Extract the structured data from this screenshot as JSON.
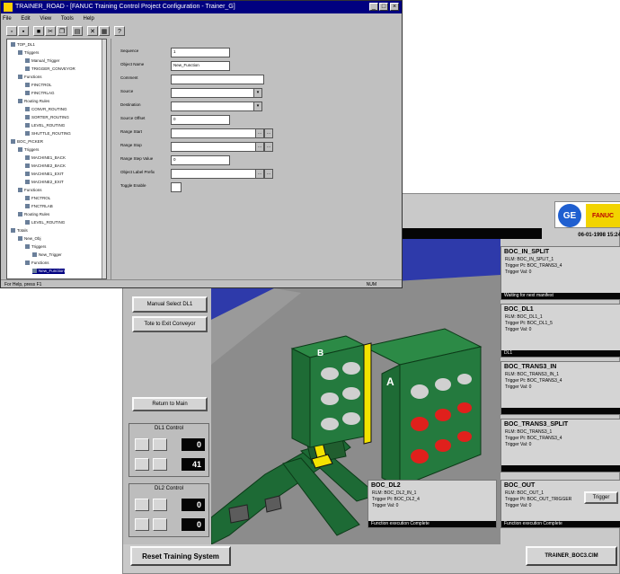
{
  "config_window": {
    "title": "TRAINER_ROAD - [FANUC Training Control Project Configuration - Trainer_G]",
    "menu": [
      "File",
      "Edit",
      "View",
      "Tools",
      "Help"
    ],
    "toolbar_icons": [
      "new-icon",
      "open-icon",
      "save-icon",
      "cut-icon",
      "copy-icon",
      "paste-icon",
      "delete-icon",
      "properties-icon",
      "help-icon"
    ],
    "tree": {
      "nodes": [
        {
          "label": "TOP_DL1",
          "level": 0
        },
        {
          "label": "Triggers",
          "level": 1
        },
        {
          "label": "Manual_Trigger",
          "level": 2
        },
        {
          "label": "TRIGGER_CONVEYOR",
          "level": 2
        },
        {
          "label": "Functions",
          "level": 1
        },
        {
          "label": "FINCTROL",
          "level": 2
        },
        {
          "label": "FINCTRLAG",
          "level": 2
        },
        {
          "label": "Routing Rules",
          "level": 1
        },
        {
          "label": "CONVR_ROUTING",
          "level": 2
        },
        {
          "label": "SORTER_ROUTING",
          "level": 2
        },
        {
          "label": "LEVEL_ROUTING",
          "level": 2
        },
        {
          "label": "SHUTTLE_ROUTING",
          "level": 2
        },
        {
          "label": "BOC_PICKER",
          "level": 0
        },
        {
          "label": "Triggers",
          "level": 1
        },
        {
          "label": "MACHINE1_BACK",
          "level": 2
        },
        {
          "label": "MACHINE2_BACK",
          "level": 2
        },
        {
          "label": "MACHINE1_EXIT",
          "level": 2
        },
        {
          "label": "MACHINE2_EXIT",
          "level": 2
        },
        {
          "label": "Functions",
          "level": 1
        },
        {
          "label": "FNCTROL",
          "level": 2
        },
        {
          "label": "FNCTRLAB",
          "level": 2
        },
        {
          "label": "Routing Rules",
          "level": 1
        },
        {
          "label": "LEVEL_ROUTING",
          "level": 2
        },
        {
          "label": "Totals",
          "level": 0
        },
        {
          "label": "New_Obj",
          "level": 1
        },
        {
          "label": "Triggers",
          "level": 2
        },
        {
          "label": "New_Trigger",
          "level": 3
        },
        {
          "label": "Functions",
          "level": 2
        },
        {
          "label": "New_Function",
          "level": 3
        }
      ]
    },
    "form": {
      "fields": [
        {
          "label": "Sequence",
          "value": "1",
          "type": "text"
        },
        {
          "label": "Object Name",
          "value": "New_Function",
          "type": "text"
        },
        {
          "label": "Comment",
          "value": "",
          "type": "text"
        },
        {
          "label": "Source",
          "value": "",
          "type": "drop"
        },
        {
          "label": "Destination",
          "value": "",
          "type": "drop"
        },
        {
          "label": "Source Offset",
          "value": "0",
          "type": "text"
        },
        {
          "label": "Range Start",
          "value": "",
          "type": "double"
        },
        {
          "label": "Range Stop",
          "value": "",
          "type": "double"
        },
        {
          "label": "Range Step Value",
          "value": "0",
          "type": "text"
        },
        {
          "label": "Object Label Prefix",
          "value": "",
          "type": "double"
        },
        {
          "label": "Toggle Enable",
          "value": "",
          "type": "check"
        }
      ]
    },
    "status": "For Help, press F1",
    "status_right": "NUM"
  },
  "hmi_window": {
    "datetime": "06-01-1998 15:24",
    "logo_left": "GE",
    "logo_right": "FANUC",
    "buttons": {
      "manual_select": "Manual Select DL1",
      "tote_exit": "Tote to Exit Conveyor",
      "return_main": "Return to Main"
    },
    "dl1_control": {
      "title": "DL1 Control",
      "top_value": "0",
      "bottom_value": "41"
    },
    "dl2_control": {
      "title": "DL2 Control",
      "top_value": "0",
      "bottom_value": "0"
    },
    "scene_labels": {
      "a": "A",
      "b": "B"
    },
    "panels": [
      {
        "title": "BOC_IN_SPLIT",
        "lines": [
          "RLM:  BOC_IN_SPLIT_1",
          "Trigger Pt:  BOC_TRANS3_4",
          "Trigger Val:  0"
        ],
        "status": "Waiting for next manifest"
      },
      {
        "title": "BOC_DL1",
        "lines": [
          "RLM:  BOC_DL1_1",
          "Trigger Pt:  BOC_DL1_5",
          "Trigger Val:  0"
        ],
        "status": "DL1"
      },
      {
        "title": "BOC_TRANS3_IN",
        "lines": [
          "RLM:  BOC_TRANS3_IN_1",
          "Trigger Pt:  BOC_TRANS3_4",
          "Trigger Val:  0"
        ],
        "status": ""
      },
      {
        "title": "BOC_TRANS3_SPLIT",
        "lines": [
          "RLM:  BOC_TRANS3_1",
          "Trigger Pt:  BOC_TRANS3_4",
          "Trigger Val:  0"
        ],
        "status": ""
      },
      {
        "title": "BOC_DL2",
        "lines": [
          "RLM:  BOC_DL2_IN_1",
          "Trigger Pt:  BOC_DL2_4",
          "Trigger Val:  0"
        ],
        "status": "Function execution Complete"
      },
      {
        "title": "BOC_OUT",
        "lines": [
          "RLM:  BOC_OUT_1",
          "Trigger Pt:  BOC_OUT_TRIGGER",
          "Trigger Val:  0"
        ],
        "status": "Function execution Complete"
      }
    ],
    "trigger_button": "Trigger",
    "reset_button": "Reset Training System",
    "site_label": "TRAINER_BOC3.CIM"
  }
}
